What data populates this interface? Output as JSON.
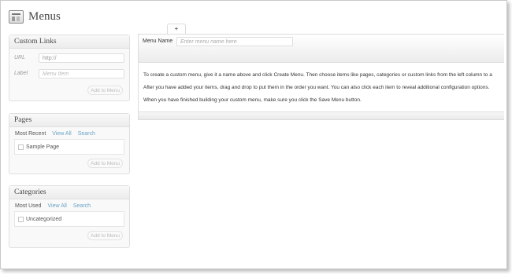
{
  "header": {
    "title": "Menus",
    "icon": "menus-icon"
  },
  "custom_links": {
    "title": "Custom Links",
    "url_label": "URL",
    "url_value": "http://",
    "label_label": "Label",
    "label_placeholder": "Menu Item",
    "button": "Add to Menu"
  },
  "pages": {
    "title": "Pages",
    "tabs": [
      "Most Recent",
      "View All",
      "Search"
    ],
    "items": [
      "Sample Page"
    ],
    "button": "Add to Menu"
  },
  "categories": {
    "title": "Categories",
    "tabs": [
      "Most Used",
      "View All",
      "Search"
    ],
    "items": [
      "Uncategorized"
    ],
    "button": "Add to Menu"
  },
  "editor": {
    "add_tab": "+",
    "menu_name_label": "Menu Name",
    "menu_name_placeholder": "Enter menu name here",
    "instructions": [
      "To create a custom menu, give it a name above and click Create Menu. Then choose items like pages, categories or custom links from the left column to a",
      "After you have added your items, drag and drop to put them in the order you want. You can also click each item to reveal additional configuration options.",
      "When you have finished building your custom menu, make sure you click the Save Menu button."
    ]
  },
  "colors": {
    "link": "#6aa3c6",
    "heading": "#464646"
  }
}
